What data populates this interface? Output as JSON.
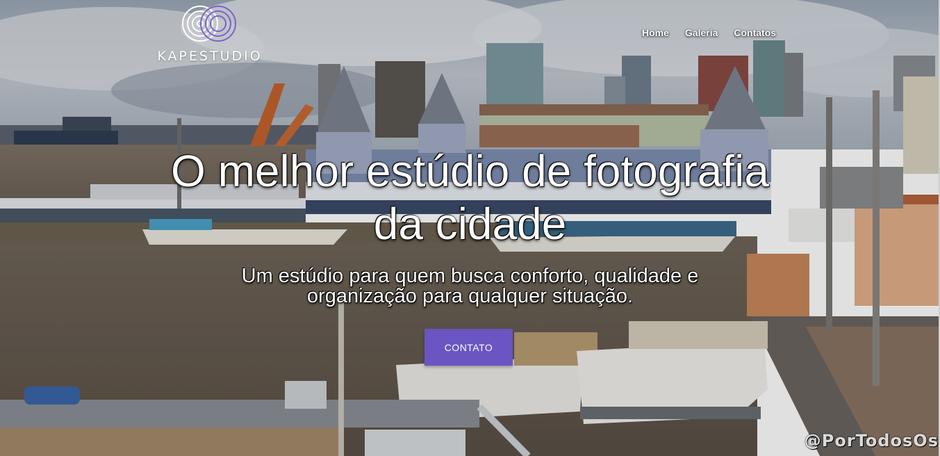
{
  "brand": {
    "name": "KAPESTUDIO",
    "accent": "#6a55c2"
  },
  "nav": {
    "items": [
      "Home",
      "Galeria",
      "Contatos"
    ]
  },
  "hero": {
    "title": "O melhor estúdio de fotografia da cidade",
    "subtitle": "Um estúdio para quem busca conforto, qualidade e organização para qualquer situação.",
    "cta_label": "CONTATO",
    "watermark": "@PorTodosOs"
  }
}
